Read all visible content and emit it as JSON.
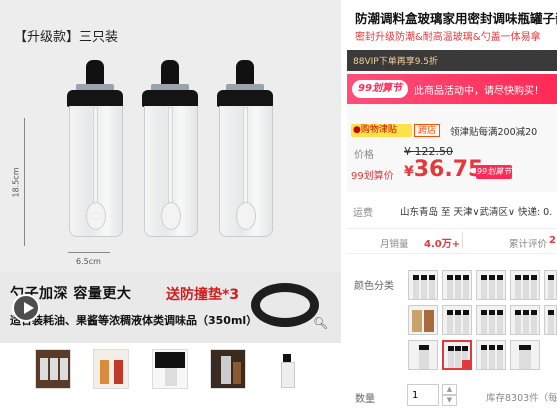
{
  "main_image": {
    "label": "【升级款】三只装",
    "dim_height": "18.5cm",
    "dim_width": "6.5cm",
    "promo_text": "勺子加深 容量更大",
    "gift_text": "送防撞垫*3",
    "sub_promo": "适合装耗油、果酱等浓稠液体类调味品（350ml）"
  },
  "product": {
    "title": "防潮调料盒玻璃家用密封调味瓶罐子酱",
    "subtitle": "密封升级防潮&耐高温玻璃&勺盖一体易拿"
  },
  "vip": {
    "text": "88VIP下单再享9.5折"
  },
  "jhs": {
    "logo": "99划算节",
    "text": "此商品活动中，请尽快购买！"
  },
  "coupon": {
    "badge": "购物津贴",
    "tag": "跨店",
    "desc": "领津贴每满200减20"
  },
  "price": {
    "label": "价格",
    "currency": "¥",
    "original": "122.50",
    "jhs_label": "99划算价",
    "jhs_value": "36.75",
    "jhs_small": "99划算节"
  },
  "shipping": {
    "label": "运费",
    "text": "山东青岛 至 天津∨武清区∨ 快递: 0."
  },
  "stats": {
    "sales_label": "月销量",
    "sales_value": "4.0万+",
    "reviews_label": "累计评价",
    "reviews_value": "2"
  },
  "options": {
    "color_label": "颜色分类",
    "quantity_label": "数量",
    "quantity_value": "1",
    "stock_text": "库存8303件（每"
  },
  "colors": {
    "accent": "#e4393c",
    "jhs_pink": "#ff2a55",
    "vip_bg": "#3a3a3a"
  }
}
